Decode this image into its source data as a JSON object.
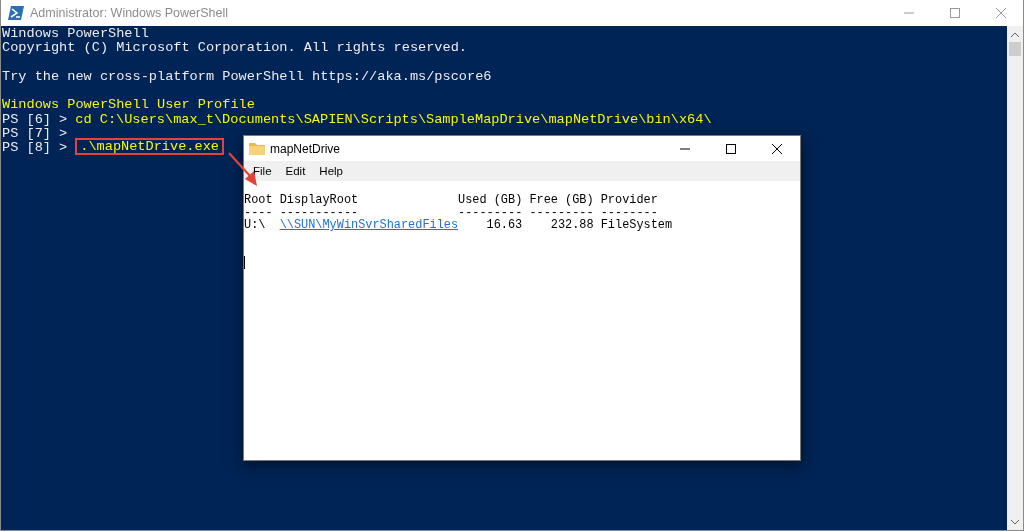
{
  "console_window": {
    "title": "Administrator: Windows PowerShell",
    "lines": [
      {
        "kind": "output",
        "text": "Windows PowerShell"
      },
      {
        "kind": "output",
        "text": "Copyright (C) Microsoft Corporation. All rights reserved."
      },
      {
        "kind": "blank"
      },
      {
        "kind": "output",
        "text": "Try the new cross-platform PowerShell https://aka.ms/pscore6"
      },
      {
        "kind": "blank"
      },
      {
        "kind": "notice",
        "text": "Windows PowerShell User Profile"
      },
      {
        "kind": "prompt",
        "prompt": "PS [6] >",
        "command": "cd C:\\Users\\max_t\\Documents\\SAPIEN\\Scripts\\SampleMapDrive\\mapNetDrive\\bin\\x64\\",
        "highlighted": false
      },
      {
        "kind": "prompt",
        "prompt": "PS [7] >"
      },
      {
        "kind": "prompt",
        "prompt": "PS [8] >",
        "command": ".\\mapNetDrive.exe",
        "highlighted": true
      }
    ]
  },
  "app_window": {
    "title": "mapNetDrive",
    "menu": [
      "File",
      "Edit",
      "Help"
    ],
    "table": {
      "columns": [
        "Root",
        "DisplayRoot",
        "Used (GB)",
        "Free (GB)",
        "Provider"
      ],
      "separators": [
        "----",
        "-----------",
        "---------",
        "---------",
        "--------"
      ],
      "rows": [
        {
          "cells": [
            {
              "kind": "text",
              "text": "U:\\"
            },
            {
              "kind": "link",
              "text": "\\\\SUN\\MyWinSvrSharedFiles"
            },
            {
              "kind": "number",
              "text": "16.63"
            },
            {
              "kind": "number",
              "text": "232.88"
            },
            {
              "kind": "text",
              "text": "FileSystem"
            }
          ]
        }
      ]
    }
  }
}
